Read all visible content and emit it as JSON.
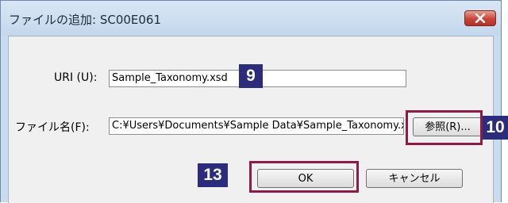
{
  "dialog": {
    "title": "ファイルの追加: SC00E061",
    "close_icon": "close-x-icon"
  },
  "uri": {
    "label": "URI (U):",
    "value": "Sample_Taxonomy.xsd"
  },
  "file": {
    "label": "ファイル名(F):",
    "value": "C:¥Users¥Documents¥Sample Data¥Sample_Taxonomy.xsd",
    "browse_label": "参照(R)..."
  },
  "buttons": {
    "ok_label": "OK",
    "cancel_label": "キャンセル"
  },
  "annotations": {
    "badge_uri": "9",
    "badge_browse": "10",
    "badge_ok": "13",
    "highlight_color": "#8e1a48",
    "badge_color": "#2b2c7c"
  }
}
